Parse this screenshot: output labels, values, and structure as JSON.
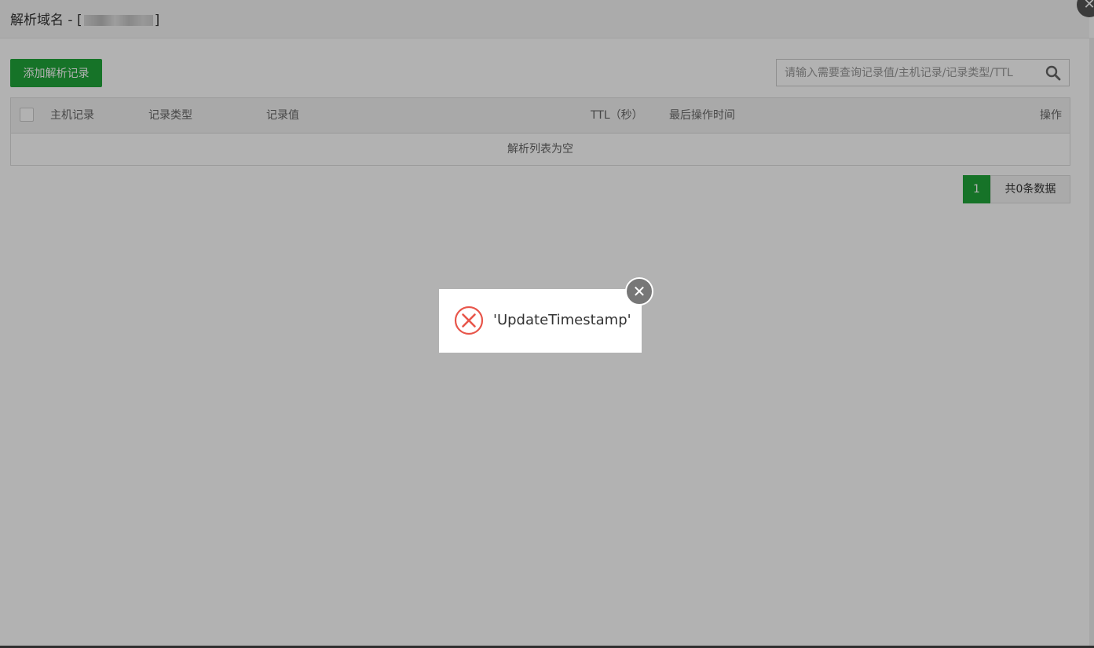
{
  "window": {
    "title_prefix": "解析域名 - [",
    "title_suffix": "]",
    "close_glyph": "✕"
  },
  "toolbar": {
    "add_label": "添加解析记录",
    "search_placeholder": "请输入需要查询记录值/主机记录/记录类型/TTL",
    "search_icon": "search-icon"
  },
  "table": {
    "columns": [
      "主机记录",
      "记录类型",
      "记录值",
      "TTL（秒）",
      "最后操作时间",
      "操作"
    ],
    "empty_text": "解析列表为空"
  },
  "pagination": {
    "current_page": "1",
    "total_text": "共0条数据"
  },
  "message": {
    "text": "'UpdateTimestamp'",
    "icon": "error-icon",
    "close_glyph": "✕"
  },
  "colors": {
    "accent_green": "#20a53a",
    "error_red": "#e8564b",
    "overlay": "rgba(0,0,0,0.3)"
  }
}
